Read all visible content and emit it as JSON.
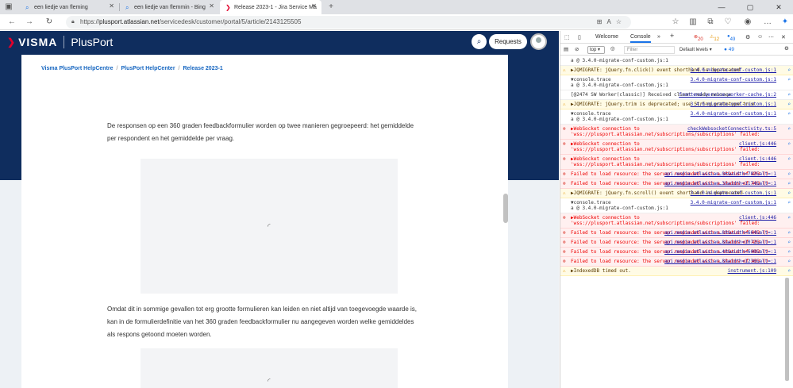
{
  "browser": {
    "tabs": [
      {
        "title": "een liedje van fleming"
      },
      {
        "title": "een liedje van flemmin - Bing"
      },
      {
        "title": "Release 2023-1 - Jira Service Ma"
      }
    ],
    "new_tab": "+",
    "url": {
      "scheme": "https://",
      "host": "plusport.atlassian.net",
      "path": "/servicedesk/customer/portal/5/article/2143125505"
    }
  },
  "header": {
    "brand": "VISMA",
    "product": "PlusPort",
    "requests_label": "Requests"
  },
  "breadcrumb": [
    "Visma PlusPort HelpCentre",
    "PlusPort HelpCenter",
    "Release 2023-1"
  ],
  "article": {
    "paragraph1": "De responsen op een 360 graden feedbackformulier worden op twee manieren gegroepeerd: het gemiddelde per respondent en het gemiddelde per vraag.",
    "paragraph2": "Omdat dit in sommige gevallen tot erg grootte formulieren kan leiden en niet altijd van toegevoegde waarde is, kan in de formulierdefinitie van het 360 graden feedbackformulier nu aangegeven worden welke gemiddeldes als respons getoond moeten worden."
  },
  "devtools": {
    "tabs": [
      "Welcome",
      "Console"
    ],
    "errors": "20",
    "warnings": "12",
    "info": "49",
    "context": "top",
    "filter_placeholder": "Filter",
    "levels": "Default levels",
    "levels_count": "49",
    "messages": [
      {
        "type": "plain",
        "text": "a @ 3.4.0-migrate-conf-custom.js:1",
        "src": ""
      },
      {
        "type": "warn",
        "text": "▶JQMIGRATE: jQuery.fn.click() event shorthand is deprecated",
        "src": "3.4.0-migrate-conf-custom.js:1"
      },
      {
        "type": "plain",
        "text": "▼console.trace",
        "src": "3.4.0-migrate-conf-custom.js:1",
        "sub": "a @ 3.4.0-migrate-conf-custom.js:1"
      },
      {
        "type": "plain",
        "text": "[@2474 SW Worker(classic)] Received client ready message",
        "src": "frontend-service-worker-cache.js:2"
      },
      {
        "type": "warn",
        "text": "▶JQMIGRATE: jQuery.trim is deprecated; use String.prototype.trim",
        "src": "3.4.0-migrate-conf-custom.js:1"
      },
      {
        "type": "plain",
        "text": "▼console.trace",
        "src": "3.4.0-migrate-conf-custom.js:1",
        "sub": "a @ 3.4.0-migrate-conf-custom.js:1"
      },
      {
        "type": "err",
        "text": "▶WebSocket connection to 'wss://plusport.atlassian.net/subscriptions/subscriptions' failed:",
        "src": "checkWebsocketConnectivity.ts:5"
      },
      {
        "type": "err",
        "text": "▶WebSocket connection to 'wss://plusport.atlassian.net/subscriptions/subscriptions' failed:",
        "src": "client.js:446"
      },
      {
        "type": "err",
        "text": "▶WebSocket connection to 'wss://plusport.atlassian.net/subscriptions/subscriptions' failed:",
        "src": "client.js:446"
      },
      {
        "type": "err",
        "text": "Failed to load resource: the server responded with a status of 403 ()",
        "src": "api.media.atlassian…96&width=782&alt=:1"
      },
      {
        "type": "err",
        "text": "Failed to load resource: the server responded with a status of 403 ()",
        "src": "api.media.atlassian…3&width=1174&alt=:1"
      },
      {
        "type": "warn",
        "text": "▶JQMIGRATE: jQuery.fn.scroll() event shorthand is deprecated",
        "src": "3.4.0-migrate-conf-custom.js:1"
      },
      {
        "type": "plain",
        "text": "▼console.trace",
        "src": "3.4.0-migrate-conf-custom.js:1",
        "sub": "a @ 3.4.0-migrate-conf-custom.js:1"
      },
      {
        "type": "err",
        "text": "▶WebSocket connection to 'wss://plusport.atlassian.net/subscriptions/subscriptions' failed:",
        "src": "client.js:446"
      },
      {
        "type": "err",
        "text": "Failed to load resource: the server responded with a status of 403 ()",
        "src": "api.media.atlassian…89&width=664&alt=:1"
      },
      {
        "type": "err",
        "text": "Failed to load resource: the server responded with a status of 403 ()",
        "src": "api.media.atlassian…8&width=1072&alt=:1"
      },
      {
        "type": "err",
        "text": "Failed to load resource: the server responded with a status of 403 ()",
        "src": "api.media.atlassian…40&width=600&alt=:1"
      },
      {
        "type": "err",
        "text": "Failed to load resource: the server responded with a status of 403 ()",
        "src": "api.media.atlassian…8&width=1236&alt=:1"
      },
      {
        "type": "warn",
        "text": "▶IndexedDB timed out.",
        "src": "instrument.js:109"
      }
    ]
  }
}
